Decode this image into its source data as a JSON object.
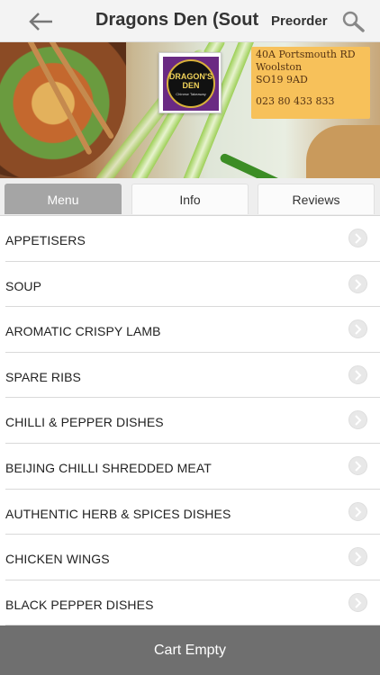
{
  "header": {
    "title": "Dragons Den (Southampton)",
    "preorder_label": "Preorder",
    "back_icon": "arrow-left-icon",
    "search_icon": "magnifier-icon"
  },
  "banner": {
    "logo": {
      "title": "DRAGON'S DEN",
      "subtitle": "Chinese Takeaway"
    },
    "address": {
      "line1": "40A Portsmouth RD",
      "line2": "Woolston",
      "line3": "SO19 9AD",
      "phone": "023 80 433 833"
    }
  },
  "tabs": [
    {
      "label": "Menu",
      "active": true
    },
    {
      "label": "Info",
      "active": false
    },
    {
      "label": "Reviews",
      "active": false
    }
  ],
  "menu": {
    "items": [
      {
        "label": "APPETISERS"
      },
      {
        "label": "SOUP"
      },
      {
        "label": "AROMATIC CRISPY LAMB"
      },
      {
        "label": "SPARE RIBS"
      },
      {
        "label": "CHILLI & PEPPER DISHES"
      },
      {
        "label": "BEIJING CHILLI SHREDDED MEAT"
      },
      {
        "label": "AUTHENTIC HERB & SPICES DISHES"
      },
      {
        "label": "CHICKEN WINGS"
      },
      {
        "label": "BLACK PEPPER DISHES"
      }
    ]
  },
  "footer": {
    "cart_label": "Cart Empty"
  },
  "colors": {
    "header_bg": "#f3f3f3",
    "tab_active": "#a5a5a5",
    "address_bg": "#f7c15a",
    "cart_bar": "#6f6f6f"
  }
}
